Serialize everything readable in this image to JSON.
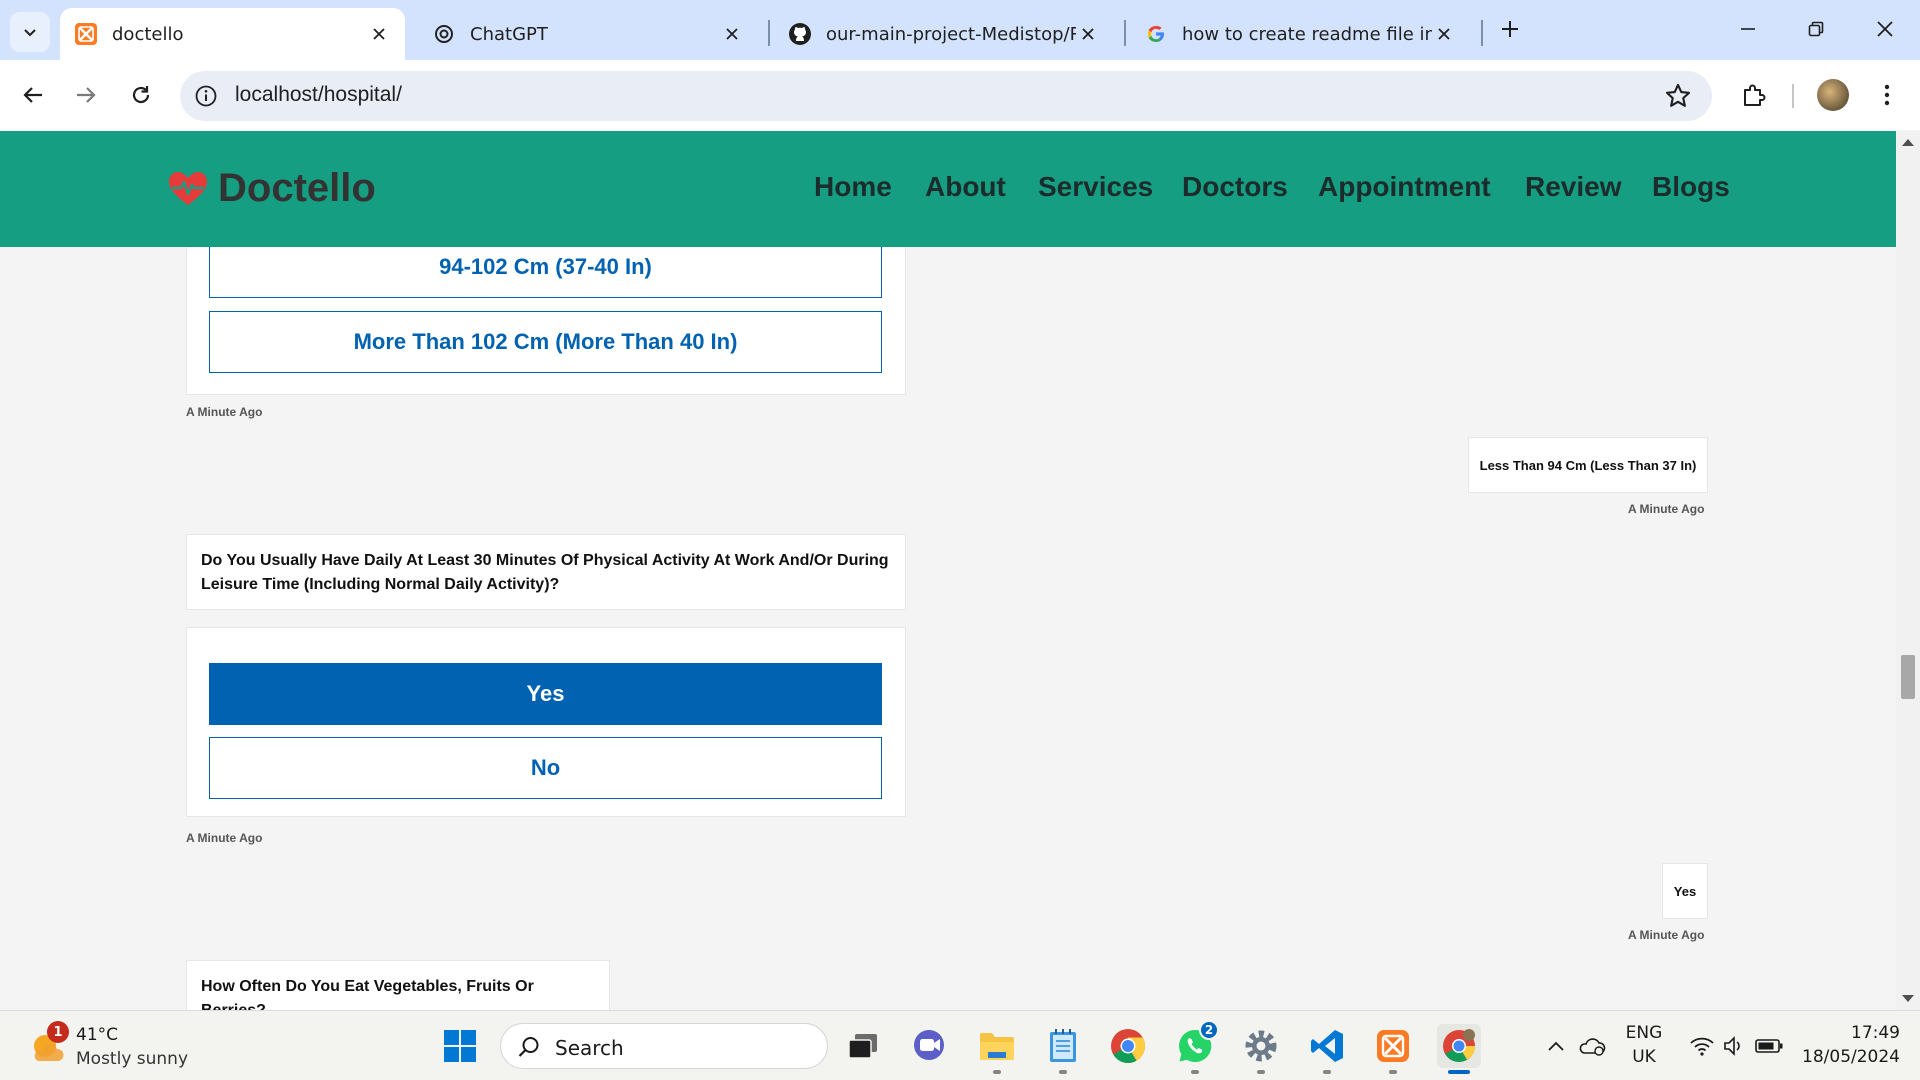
{
  "browser": {
    "tabs": [
      {
        "title": "doctello",
        "active": true,
        "favicon": "xampp-icon"
      },
      {
        "title": "ChatGPT",
        "active": false,
        "favicon": "chatgpt-icon"
      },
      {
        "title": "our-main-project-Medistop/RE",
        "active": false,
        "favicon": "github-icon"
      },
      {
        "title": "how to create readme file in vs",
        "active": false,
        "favicon": "google-icon"
      }
    ],
    "url": "localhost/hospital/"
  },
  "site": {
    "brand": "Doctello",
    "brand_color": "#169e82",
    "nav": [
      "Home",
      "About",
      "Services",
      "Doctors",
      "Appointment",
      "Review",
      "Blogs"
    ]
  },
  "chat": {
    "q1_options": [
      "94-102 Cm (37-40 In)",
      "More Than 102 Cm (More Than 40 In)"
    ],
    "q1_time": "A Minute Ago",
    "reply1": "Less Than 94 Cm (Less Than 37 In)",
    "reply1_time": "A Minute Ago",
    "q2_text": "Do You Usually Have Daily At Least 30 Minutes Of Physical Activity At Work And/Or During Leisure Time (Including Normal Daily Activity)?",
    "q2_options": [
      "Yes",
      "No"
    ],
    "q2_selected": "Yes",
    "q2_time": "A Minute Ago",
    "reply2": "Yes",
    "reply2_time": "A Minute Ago",
    "q3_text": "How Often Do You Eat Vegetables, Fruits Or Berries?",
    "accent_color": "#0062b1"
  },
  "taskbar": {
    "weather_temp": "41°C",
    "weather_desc": "Mostly sunny",
    "weather_badge": "1",
    "search_placeholder": "Search",
    "whatsapp_badge": "2",
    "lang_top": "ENG",
    "lang_bottom": "UK",
    "time": "17:49",
    "date": "18/05/2024"
  }
}
